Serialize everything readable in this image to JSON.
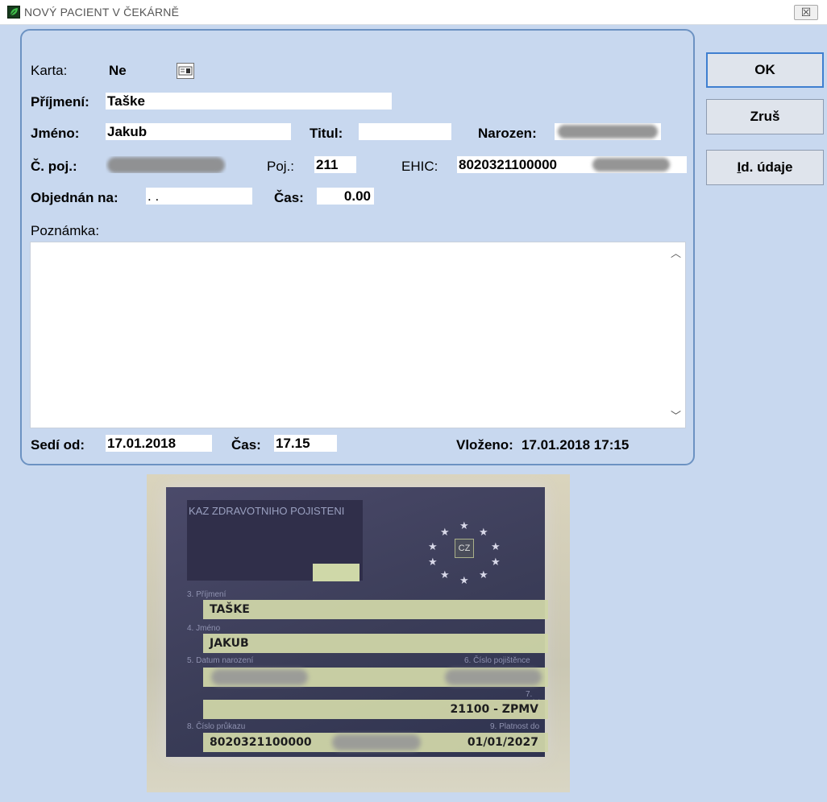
{
  "window": {
    "title": "NOVÝ PACIENT V ČEKÁRNĚ",
    "close_label": "☒"
  },
  "form": {
    "karta_label": "Karta:",
    "karta_value": "Ne",
    "prijmeni_label": "Příjmení:",
    "prijmeni_value": "Taške",
    "jmeno_label": "Jméno:",
    "jmeno_value": "Jakub",
    "titul_label": "Titul:",
    "titul_value": "",
    "narozen_label": "Narozen:",
    "cpoj_label": "Č. poj.:",
    "poj_label": "Poj.:",
    "poj_value": "211",
    "ehic_label": "EHIC:",
    "ehic_value": "8020321100000",
    "objednan_label": "Objednán na:",
    "objednan_value": " .  .",
    "cas_label": "Čas:",
    "cas_value": "0.00",
    "poznamka_label": "Poznámka:",
    "poznamka_value": "",
    "sedi_label": "Sedí od:",
    "sedi_value": "17.01.2018",
    "cas2_label": "Čas:",
    "cas2_value": "17.15",
    "vlozeno_label": "Vloženo:",
    "vlozeno_value": "17.01.2018 17:15"
  },
  "buttons": {
    "ok": "OK",
    "cancel": "Zruš",
    "id_prefix": "I",
    "id_rest": "d. údaje"
  },
  "card": {
    "header": "KAZ ZDRAVOTNIHO POJISTENI",
    "country": "CZ",
    "label_surname": "3. Příjmení",
    "surname": "TAŠKE",
    "label_name": "4. Jméno",
    "name": "JAKUB",
    "label_dob": "5. Datum narození",
    "label_insno": "6. Číslo pojištěnce",
    "label_zp": "7. Kód ZP",
    "zp": "21100 - ZPMV",
    "label_cardno": "8. Číslo průkazu",
    "label_valid": "9. Platnost do",
    "cardno": "8020321100000",
    "valid": "01/01/2027"
  }
}
